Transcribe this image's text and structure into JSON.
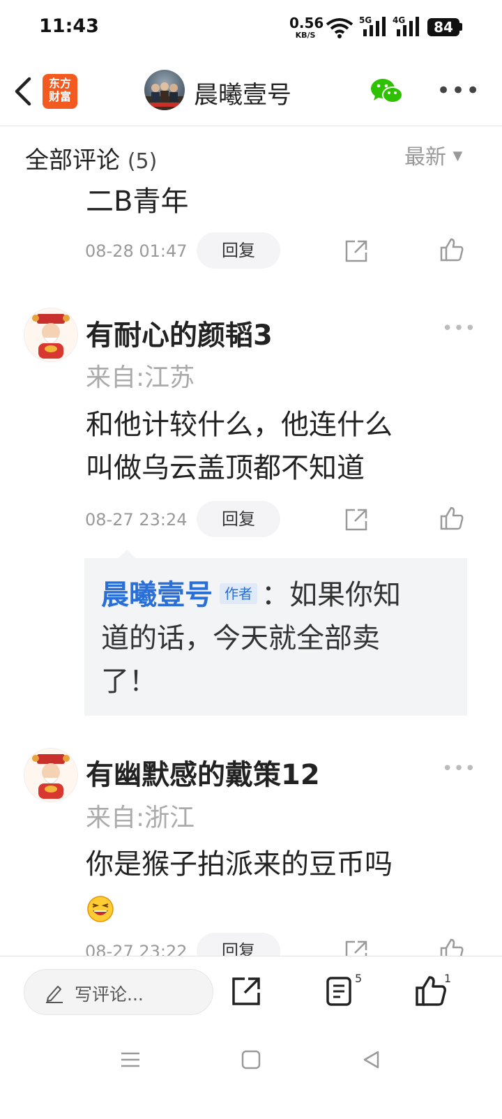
{
  "status_bar": {
    "time": "11:43",
    "speed_value": "0.56",
    "speed_unit": "KB/S",
    "net1": "5G",
    "net2": "4G",
    "battery": "84"
  },
  "header": {
    "logo_text_line1": "东方",
    "logo_text_line2": "财富",
    "author_name": "晨曦壹号"
  },
  "comments_section": {
    "title": "全部评论",
    "count": "(5)",
    "sort_label": "最新"
  },
  "comments": [
    {
      "text": "二B青年",
      "date": "08-28 01:47",
      "reply_label": "回复"
    },
    {
      "username": "有耐心的颜韬3",
      "location": "来自:江苏",
      "text_line1": "和他计较什么，他连什么",
      "text_line2": "叫做乌云盖顶都不知道",
      "date": "08-27 23:24",
      "reply_label": "回复",
      "reply": {
        "author": "晨曦壹号",
        "tag": "作者",
        "text_line1": "：如果你知",
        "text_line2": "道的话，今天就全部卖",
        "text_line3": "了！"
      }
    },
    {
      "username": "有幽默感的戴策12",
      "location": "来自:浙江",
      "text": "你是猴子拍派来的豆币吗",
      "date": "08-27 23:22",
      "reply_label": "回复"
    }
  ],
  "bottom_bar": {
    "write_placeholder": "写评论...",
    "comment_count": "5",
    "like_count": "1"
  },
  "colors": {
    "brand_orange": "#f25a1f",
    "author_blue": "#2a6fd6",
    "wechat_green": "#2dc100"
  }
}
